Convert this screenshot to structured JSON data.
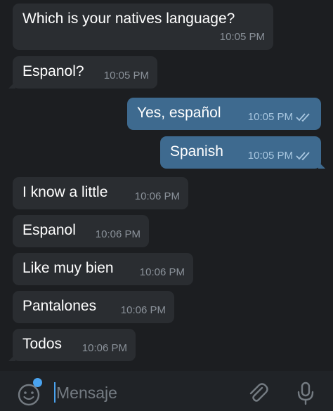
{
  "messages": [
    {
      "direction": "in",
      "text": "Which is your natives language?",
      "time": "10:05 PM"
    },
    {
      "direction": "in",
      "text": "Espanol?",
      "time": "10:05 PM"
    },
    {
      "direction": "out",
      "text": "Yes, español",
      "time": "10:05 PM",
      "status": "read"
    },
    {
      "direction": "out",
      "text": "Spanish",
      "time": "10:05 PM",
      "status": "read"
    },
    {
      "direction": "in",
      "text": "I know a little",
      "time": "10:06 PM"
    },
    {
      "direction": "in",
      "text": "Espanol",
      "time": "10:06 PM"
    },
    {
      "direction": "in",
      "text": "Like muy bien",
      "time": "10:06 PM"
    },
    {
      "direction": "in",
      "text": "Pantalones",
      "time": "10:06 PM"
    },
    {
      "direction": "in",
      "text": "Todos",
      "time": "10:06 PM"
    }
  ],
  "composer": {
    "placeholder": "Mensaje",
    "value": "",
    "emoji_icon": "emoji-smile-icon",
    "attach_icon": "paperclip-icon",
    "mic_icon": "microphone-icon"
  },
  "colors": {
    "background": "#1c1e21",
    "incoming_bubble": "#2a2d31",
    "outgoing_bubble": "#3e6a8f",
    "accent": "#4aa3ef"
  }
}
